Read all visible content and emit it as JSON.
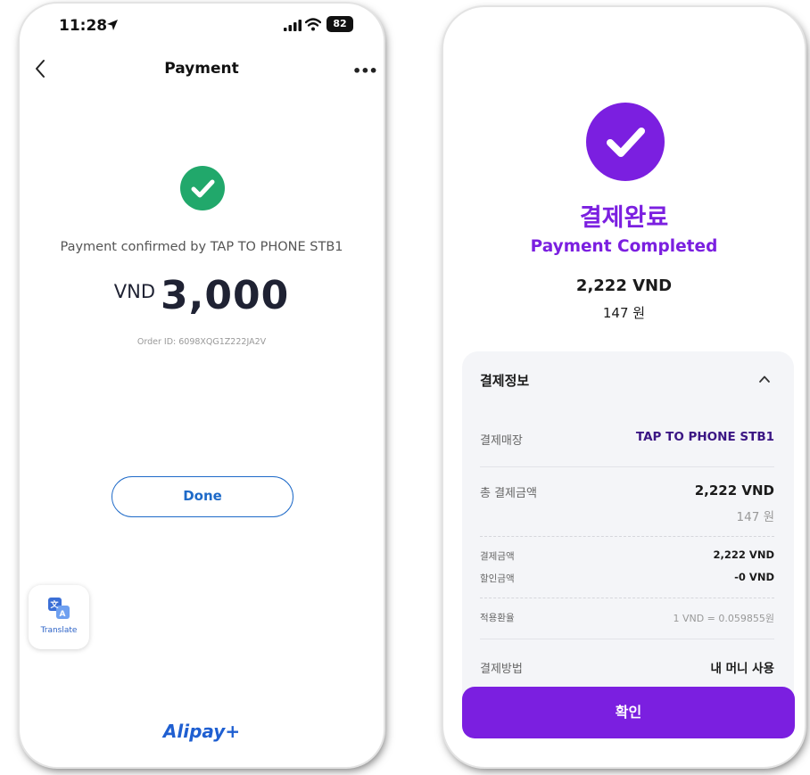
{
  "left_screen": {
    "status_bar": {
      "time": "11:28",
      "battery": "82"
    },
    "nav": {
      "title": "Payment",
      "more": "•••"
    },
    "confirmation": "Payment confirmed by TAP TO PHONE STB1",
    "amount": {
      "currency": "VND",
      "value": "3,000"
    },
    "order_id": "Order ID: 6098XQG1Z222JA2V",
    "done_label": "Done",
    "translate_label": "Translate",
    "brand": "Alipay+",
    "colors": {
      "success": "#21a86b",
      "accent": "#1e6ac8"
    }
  },
  "right_screen": {
    "title_ko": "결제완료",
    "title_en": "Payment Completed",
    "amount_vnd": "2,222 VND",
    "amount_krw": "147 원",
    "panel": {
      "header": "결제정보",
      "merchant_label": "결제매장",
      "merchant_value": "TAP TO PHONE STB1",
      "total_label": "총 결제금액",
      "total_value": "2,222 VND",
      "total_krw": "147 원",
      "pay_amount_label": "결제금액",
      "pay_amount_value": "2,222 VND",
      "discount_label": "할인금액",
      "discount_value": "-0 VND",
      "rate_label": "적용환율",
      "rate_value": "1 VND = 0.059855원",
      "method_label": "결제방법",
      "method_value": "내 머니 사용"
    },
    "confirm_label": "확인",
    "colors": {
      "accent": "#7b1fe0"
    }
  }
}
